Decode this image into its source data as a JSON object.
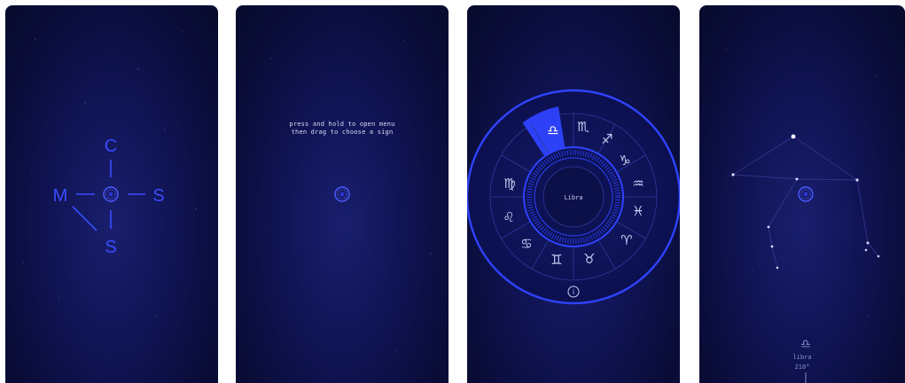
{
  "screens": [
    {
      "id": "compass",
      "letters": {
        "top": "C",
        "left": "M",
        "right": "S",
        "bottom": "S"
      }
    },
    {
      "id": "hint",
      "hint_line1": "press and hold to open menu",
      "hint_line2": "then drag to choose a sign"
    },
    {
      "id": "zodiac-menu",
      "center_label": "Libra",
      "selected_sign": "libra",
      "signs": [
        "libra",
        "scorpio",
        "sagittarius",
        "capricorn",
        "aquarius",
        "pisces",
        "aries",
        "taurus",
        "gemini",
        "cancer",
        "leo",
        "virgo"
      ],
      "info_icon": "info-icon"
    },
    {
      "id": "constellation",
      "sign_name": "libra",
      "degrees": "210°"
    }
  ],
  "colors": {
    "accent": "#3a4cff",
    "glow": "#5c6dff",
    "text": "#d8dcf5",
    "background": "#0c1048"
  }
}
